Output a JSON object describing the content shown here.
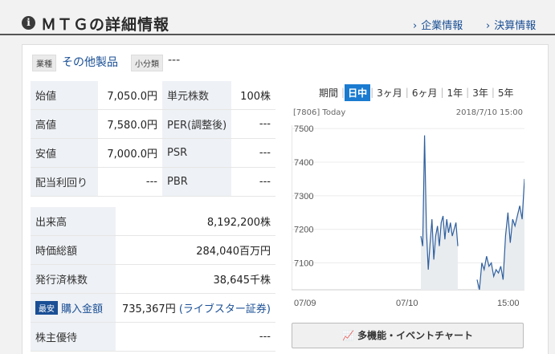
{
  "header": {
    "title": "ＭＴＧの詳細情報",
    "links": [
      "企業情報",
      "決算情報"
    ]
  },
  "category": {
    "industry_tag": "業種",
    "industry_value": "その他製品",
    "subcategory_tag": "小分類",
    "subcategory_value": "---"
  },
  "quote_left": [
    {
      "label": "始値",
      "value": "7,050.0円"
    },
    {
      "label": "高値",
      "value": "7,580.0円"
    },
    {
      "label": "安値",
      "value": "7,000.0円"
    },
    {
      "label": "配当利回り",
      "value": "---"
    }
  ],
  "quote_right": [
    {
      "label": "単元株数",
      "value": "100株"
    },
    {
      "label": "PER(調整後)",
      "value": "---"
    },
    {
      "label": "PSR",
      "value": "---"
    },
    {
      "label": "PBR",
      "value": "---"
    }
  ],
  "stats": [
    {
      "label": "出来高",
      "value": "8,192,200株"
    },
    {
      "label": "時価総額",
      "value": "284,040百万円"
    },
    {
      "label": "発行済株数",
      "value": "38,645千株"
    }
  ],
  "purchase": {
    "badge": "最安",
    "label": "購入金額",
    "value": "735,367円",
    "broker": "(ライブスター証券)"
  },
  "shareholder": {
    "label": "株主優待",
    "value": "---"
  },
  "range_tabs": [
    "期間",
    "日中",
    "3ヶ月",
    "6ヶ月",
    "1年",
    "3年",
    "5年"
  ],
  "range_active": "日中",
  "chart_meta": {
    "code": "[7806] Today",
    "datetime": "2018/7/10 15:00"
  },
  "multi_button": "多機能・イベントチャート",
  "colors": {
    "link": "#1a4f95",
    "accent": "#1a7bd0",
    "line": "#2f5f9e"
  },
  "chart_data": {
    "type": "line",
    "x_labels": [
      "07/09",
      "07/10",
      "15:00"
    ],
    "y_ticks": [
      7100,
      7200,
      7300,
      7400,
      7500
    ],
    "ylim": [
      7020,
      7510
    ],
    "grid": true,
    "series": [
      {
        "segment": "morning",
        "values": [
          7180,
          7150,
          7480,
          7200,
          7080,
          7160,
          7230,
          7110,
          7180,
          7210,
          7150,
          7220,
          7240,
          7170,
          7230,
          7190,
          7220,
          7180,
          7200,
          7220,
          7150
        ]
      },
      {
        "segment": "afternoon",
        "values": [
          7050,
          7020,
          7100,
          7080,
          7120,
          7090,
          7100,
          7060,
          7080,
          7070,
          7090,
          7050,
          7180,
          7250,
          7160,
          7230,
          7210,
          7240,
          7270,
          7230,
          7350
        ]
      }
    ]
  }
}
